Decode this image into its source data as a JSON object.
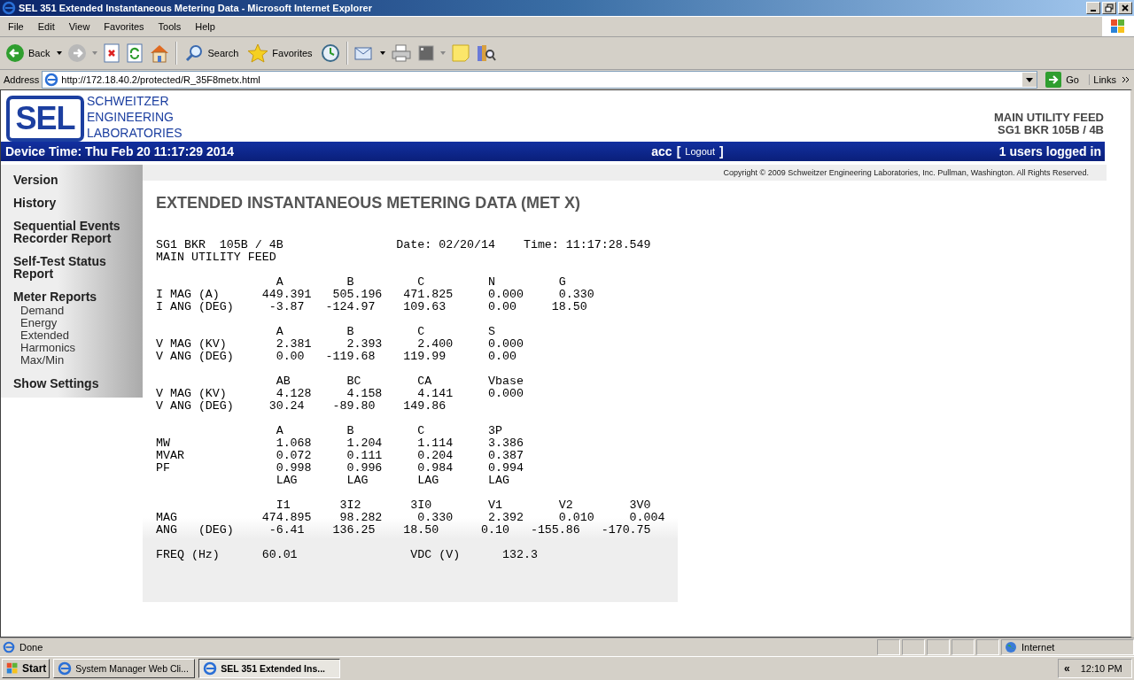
{
  "window": {
    "title": "SEL 351 Extended Instantaneous Metering Data - Microsoft Internet Explorer"
  },
  "menu": [
    "File",
    "Edit",
    "View",
    "Favorites",
    "Tools",
    "Help"
  ],
  "toolbar": {
    "back": "Back",
    "search": "Search",
    "favorites": "Favorites"
  },
  "address": {
    "label": "Address",
    "url": "http://172.18.40.2/protected/R_35F8metx.html",
    "go": "Go",
    "links": "Links"
  },
  "header": {
    "logo": "SEL",
    "company": [
      "SCHWEITZER",
      "ENGINEERING",
      "LABORATORIES"
    ],
    "device": [
      "MAIN UTILITY FEED",
      "SG1 BKR 105B / 4B"
    ]
  },
  "bar": {
    "device_time": "Device Time: Thu Feb 20 11:17:29 2014",
    "user": "acc",
    "logout": "Logout",
    "open_bracket": "[",
    "close_bracket": "]",
    "users": "1 users logged in"
  },
  "sidebar": {
    "items": [
      {
        "label": "Version"
      },
      {
        "label": "History"
      },
      {
        "label": "Sequential Events Recorder Report"
      },
      {
        "label": "Self-Test Status Report"
      },
      {
        "label": "Meter Reports",
        "children": [
          {
            "label": "Demand"
          },
          {
            "label": "Energy"
          },
          {
            "label": "Extended"
          },
          {
            "label": "Harmonics"
          },
          {
            "label": "Max/Min"
          }
        ]
      },
      {
        "label": "Show Settings"
      }
    ]
  },
  "copyright": "Copyright © 2009 Schweitzer Engineering Laboratories, Inc. Pullman, Washington. All Rights Reserved.",
  "heading": "EXTENDED INSTANTANEOUS METERING DATA (MET X)",
  "report": [
    [
      "SG1 BKR  105B / 4B                Date: 02/20/14    Time: 11:17:28.549",
      "MAIN UTILITY FEED"
    ],
    [
      "                 A         B         C         N         G",
      "I MAG (A)      449.391   505.196   471.825     0.000     0.330",
      "I ANG (DEG)     -3.87   -124.97    109.63      0.00     18.50"
    ],
    [
      "                 A         B         C         S",
      "V MAG (KV)       2.381     2.393     2.400     0.000",
      "V ANG (DEG)      0.00   -119.68    119.99      0.00"
    ],
    [
      "                 AB        BC        CA        Vbase",
      "V MAG (KV)       4.128     4.158     4.141     0.000",
      "V ANG (DEG)     30.24    -89.80    149.86"
    ],
    [
      "                 A         B         C         3P",
      "MW               1.068     1.204     1.114     3.386",
      "MVAR             0.072     0.111     0.204     0.387",
      "PF               0.998     0.996     0.984     0.994",
      "                 LAG       LAG       LAG       LAG"
    ],
    [
      "                 I1       3I2       3I0        V1        V2        3V0",
      "MAG            474.895    98.282     0.330     2.392     0.010     0.004",
      "ANG   (DEG)     -6.41    136.25    18.50      0.10   -155.86   -170.75"
    ],
    [
      "FREQ (Hz)      60.01                VDC (V)      132.3"
    ]
  ],
  "status_bar": {
    "text": "Done",
    "zone": "Internet"
  },
  "taskbar": {
    "start": "Start",
    "tasks": [
      {
        "label": "System Manager Web Cli...",
        "selected": false
      },
      {
        "label": "SEL 351 Extended Ins...",
        "selected": true
      }
    ],
    "tray_toggle": "«",
    "clock": "12:10 PM"
  }
}
